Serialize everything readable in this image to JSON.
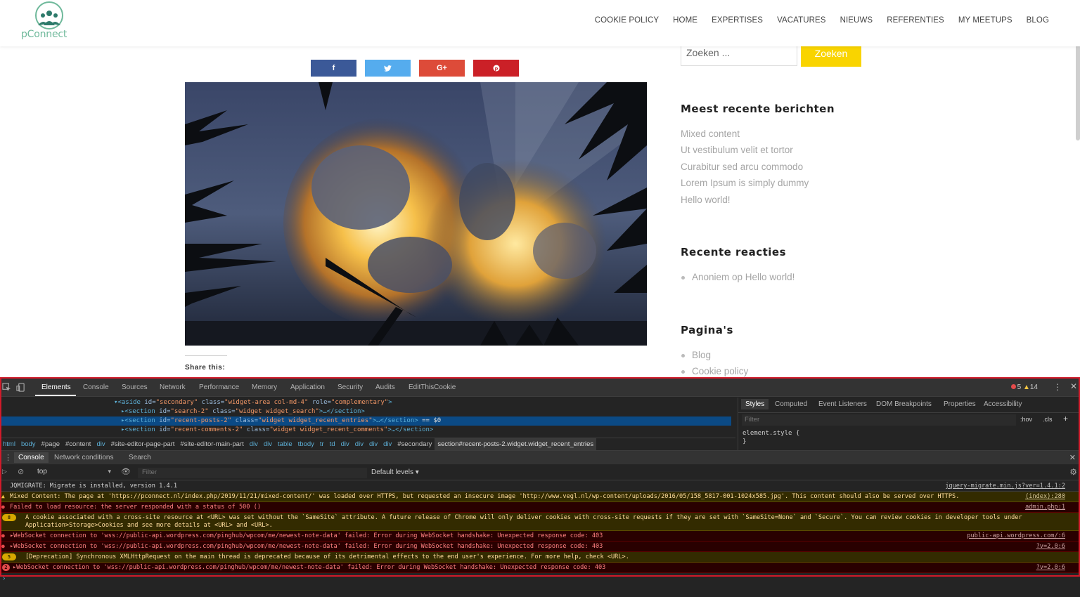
{
  "site": {
    "logo_text": "pConnect",
    "nav": [
      "COOKIE POLICY",
      "HOME",
      "EXPERTISES",
      "VACATURES",
      "NIEUWS",
      "REFERENTIES",
      "MY MEETUPS",
      "BLOG"
    ]
  },
  "share_buttons": [
    {
      "network": "facebook",
      "glyph": "f",
      "color": "#3b5998"
    },
    {
      "network": "twitter",
      "glyph": "🐦",
      "color": "#55acee"
    },
    {
      "network": "google-plus",
      "glyph": "G+",
      "color": "#dd4b39"
    },
    {
      "network": "pinterest",
      "glyph": "℗",
      "color": "#cb2027"
    }
  ],
  "share_title": "Share this:",
  "sidebar": {
    "search_placeholder": "Zoeken ...",
    "search_button": "Zoeken",
    "recent_posts_title": "Meest recente berichten",
    "recent_posts": [
      "Mixed content",
      "Ut vestibulum velit et tortor",
      "Curabitur sed arcu commodo",
      "Lorem Ipsum is simply dummy",
      "Hello world!"
    ],
    "recent_comments_title": "Recente reacties",
    "recent_comments": [
      "Anoniem op Hello world!"
    ],
    "pages_title": "Pagina's",
    "pages": [
      "Blog",
      "Cookie policy"
    ]
  },
  "devtools": {
    "tabs": [
      "Elements",
      "Console",
      "Sources",
      "Network",
      "Performance",
      "Memory",
      "Application",
      "Security",
      "Audits",
      "EditThisCookie"
    ],
    "active_tab": "Elements",
    "error_count": "5",
    "warning_count": "14",
    "elements_lines": [
      "▾<aside id=\"secondary\" class=\"widget-area col-md-4\" role=\"complementary\">",
      "▸<section id=\"search-2\" class=\"widget widget_search\">…</section>",
      "▸<section id=\"recent-posts-2\" class=\"widget widget_recent_entries\">…</section> == $0",
      "▸<section id=\"recent-comments-2\" class=\"widget widget_recent_comments\">…</section>"
    ],
    "breadcrumbs": [
      "html",
      "body",
      "#page",
      "#content",
      "div",
      "#site-editor-page-part",
      "#site-editor-main-part",
      "div",
      "div",
      "table",
      "tbody",
      "tr",
      "td",
      "div",
      "div",
      "div",
      "div",
      "#secondary",
      "section#recent-posts-2.widget.widget_recent_entries"
    ],
    "styles_tabs": [
      "Styles",
      "Computed",
      "Event Listeners",
      "DOM Breakpoints",
      "Properties",
      "Accessibility"
    ],
    "styles_filter": "Filter",
    "styles_hov": ":hov",
    "styles_cls": ".cls",
    "styles_rule_open": "element.style {",
    "styles_rule_close": "}",
    "drawer_tabs": [
      "Console",
      "Network conditions",
      "Search"
    ],
    "console_context": "top",
    "console_filter": "Filter",
    "console_levels": "Default levels ▾",
    "messages": [
      {
        "level": "info",
        "badge": "",
        "text": "JQMIGRATE: Migrate is installed, version 1.4.1",
        "source": "jquery-migrate.min.js?ver=1.4.1:2"
      },
      {
        "level": "warn",
        "badge": "",
        "text": "Mixed Content: The page at 'https://pconnect.nl/index.php/2019/11/21/mixed-content/' was loaded over HTTPS, but requested an insecure image 'http://www.vegl.nl/wp-content/uploads/2016/05/158_5817-001-1024x585.jpg'. This content should also be served over HTTPS.",
        "source": "(index):280"
      },
      {
        "level": "error",
        "badge": "",
        "text": "Failed to load resource: the server responded with a status of 500 ()",
        "source": "admin.php:1"
      },
      {
        "level": "warn",
        "badge": "8",
        "text": "A cookie associated with a cross-site resource at <URL> was set without the `SameSite` attribute. A future release of Chrome will only deliver cookies with cross-site requests if they are set with `SameSite=None` and `Secure`. You can review cookies in developer tools under Application>Storage>Cookies and see more details at <URL> and <URL>.",
        "source": ""
      },
      {
        "level": "error",
        "badge": "",
        "text": "▸WebSocket connection to 'wss://public-api.wordpress.com/pinghub/wpcom/me/newest-note-data' failed: Error during WebSocket handshake: Unexpected response code: 403",
        "source": "public-api.wordpress.com/:6"
      },
      {
        "level": "error",
        "badge": "",
        "text": "▸WebSocket connection to 'wss://public-api.wordpress.com/pinghub/wpcom/me/newest-note-data' failed: Error during WebSocket handshake: Unexpected response code: 403",
        "source": "?v=2.0:6"
      },
      {
        "level": "warn",
        "badge": "5",
        "text": "[Deprecation] Synchronous XMLHttpRequest on the main thread is deprecated because of its detrimental effects to the end user's experience. For more help, check <URL>.",
        "source": ""
      },
      {
        "level": "error",
        "badge": "2",
        "text": "▸WebSocket connection to 'wss://public-api.wordpress.com/pinghub/wpcom/me/newest-note-data' failed: Error during WebSocket handshake: Unexpected response code: 403",
        "source": "?v=2.0:6"
      }
    ]
  }
}
